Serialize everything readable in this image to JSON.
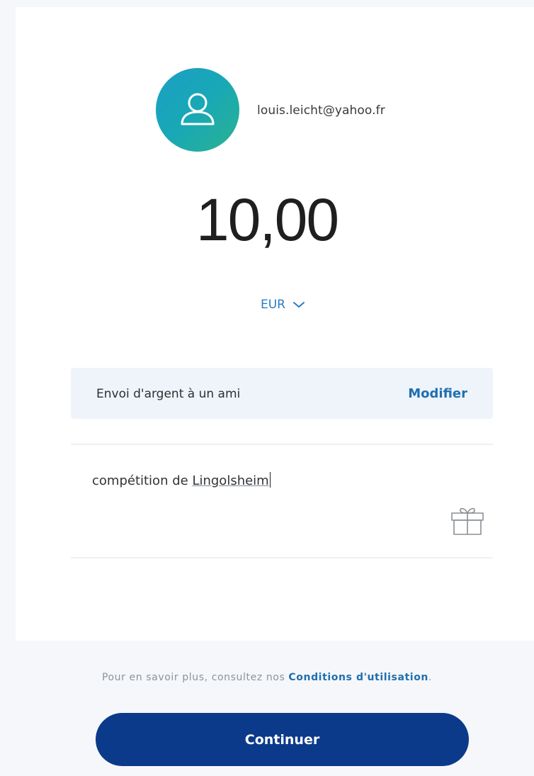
{
  "recipient": {
    "email": "louis.leicht@yahoo.fr",
    "avatar_icon": "user-icon"
  },
  "payment": {
    "amount": "10,00",
    "currency": "EUR",
    "currency_icon": "chevron-down-icon"
  },
  "transfer_type": {
    "label": "Envoi d'argent à un ami",
    "edit_label": "Modifier"
  },
  "note": {
    "text_prefix": "compétition de ",
    "text_underlined": "Lingolsheim",
    "gift_icon": "gift-icon"
  },
  "footer": {
    "terms_prefix": "Pour en savoir plus, consultez nos ",
    "terms_link": "Conditions d'utilisation",
    "terms_suffix": ".",
    "continue_label": "Continuer"
  },
  "colors": {
    "primary_button": "#0b3a8a",
    "link": "#1f6fb0",
    "avatar_gradient_start": "#1a9fc4",
    "avatar_gradient_end": "#2ab28f",
    "type_row_bg": "#eef4fa"
  }
}
